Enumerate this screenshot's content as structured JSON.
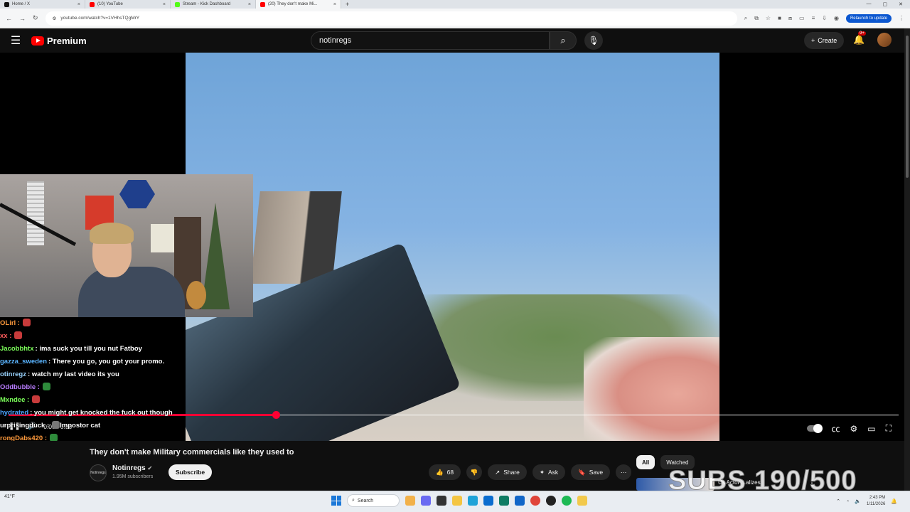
{
  "browser": {
    "tabs": [
      {
        "label": "Home / X",
        "color": "#111111"
      },
      {
        "label": "(10) YouTube",
        "color": "#ff0000"
      },
      {
        "label": "Stream - Kick Dashboard",
        "color": "#53fc18"
      },
      {
        "label": "(20) They don't make Mi...",
        "color": "#ff0000",
        "active": true
      }
    ],
    "url": "youtube.com/watch?v=1VHhsTQgMrY",
    "relaunch_label": "Relaunch to update"
  },
  "youtube": {
    "logo_text": "Premium",
    "search_value": "notinregs",
    "create_label": "Create",
    "notif_count": "9+"
  },
  "chat": [
    {
      "user": "OLirl :",
      "color": "#ff9a3c",
      "text": ""
    },
    {
      "user": "xx :",
      "color": "#ff5c5c",
      "text": ""
    },
    {
      "user": "Jacobbhtx",
      "color": "#7cff5a",
      "text": ": ima suck you till you nut Fatboy"
    },
    {
      "user": "gazza_sweden",
      "color": "#5ab4ff",
      "text": ": There you go, you got your promo."
    },
    {
      "user": "otinregz",
      "color": "#9ad4ff",
      "text": ": watch my last video its you"
    },
    {
      "user": "Oddbubble :",
      "color": "#b97dff",
      "text": ""
    },
    {
      "user": "Mxndee :",
      "color": "#7cff5a",
      "text": ""
    },
    {
      "user": "hydrated",
      "color": "#4aa3ff",
      "text": ": you might get knocked the fuck out though"
    },
    {
      "user": "urprisingduck :",
      "color": "#ffffff",
      "text": "Impostor cat"
    },
    {
      "user": "rongDabs420 :",
      "color": "#ff9a3c",
      "text": ""
    }
  ],
  "player": {
    "current_time": "0:09",
    "duration": "0:30",
    "progress": 0.3
  },
  "video": {
    "title": "They don't make Military commercials like they used to",
    "channel": "Notinregs",
    "subscribers": "1.95M subscribers",
    "subscribe_label": "Subscribe",
    "likes": "68",
    "share_label": "Share",
    "ask_label": "Ask",
    "save_label": "Save",
    "channel_logo_text": "Notinregs"
  },
  "recommendations": {
    "chips": [
      "All",
      "Watched"
    ],
    "first_title": "Us Actor ...alizes"
  },
  "overlay": {
    "subs_goal": "SUBS 190/500"
  },
  "taskbar": {
    "search_label": "Search",
    "time": "2:43 PM",
    "date": "1/11/2026",
    "weather": "41°F"
  },
  "colors": {
    "accent": "#ff0033",
    "youtube_red": "#ff0000",
    "background": "#0f0f0f"
  }
}
